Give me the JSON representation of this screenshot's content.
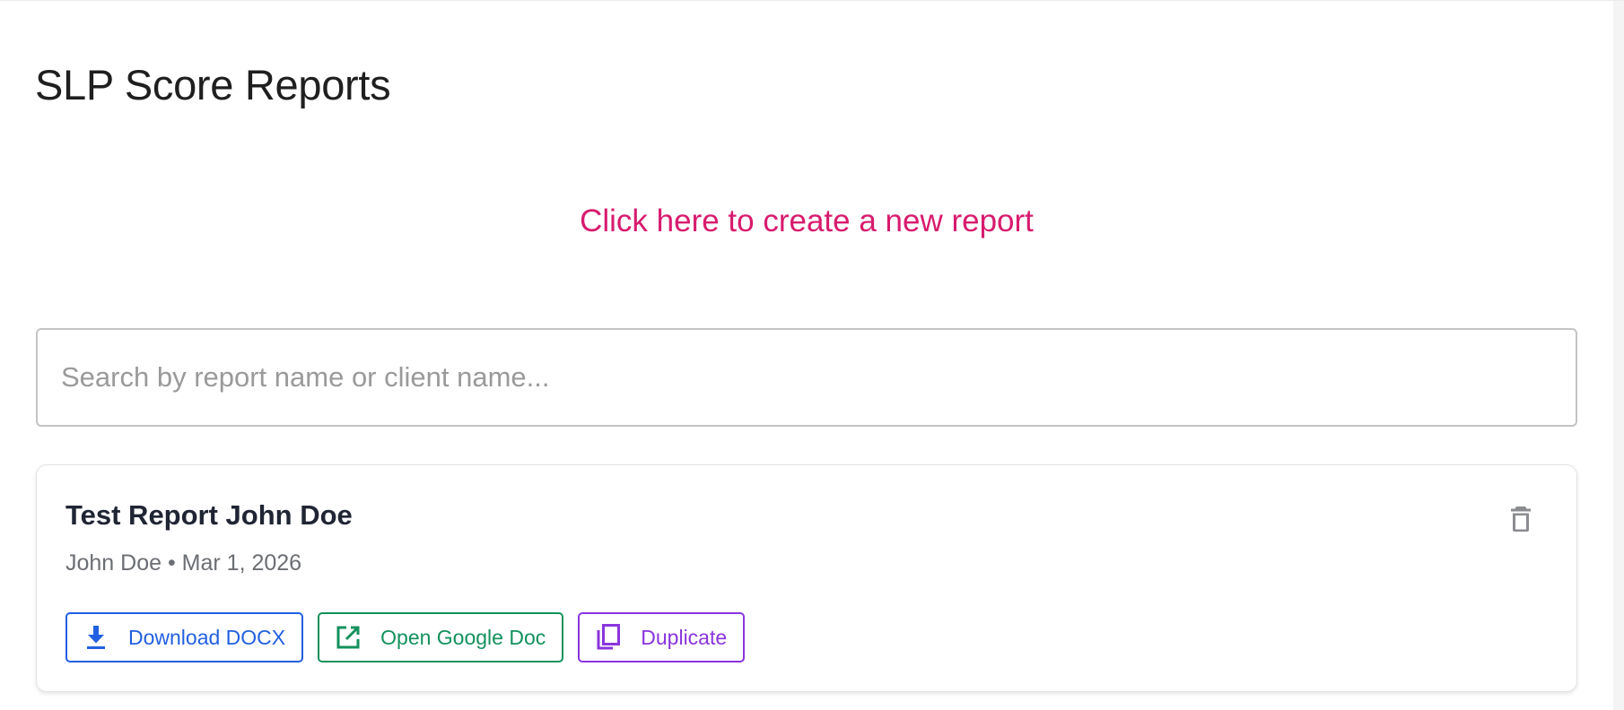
{
  "page": {
    "title": "SLP Score Reports",
    "create_link": "Click here to create a new report"
  },
  "search": {
    "placeholder": "Search by report name or client name...",
    "value": ""
  },
  "reports": [
    {
      "title": "Test Report John Doe",
      "meta": "John Doe • Mar 1, 2026",
      "actions": {
        "download": {
          "label": "Download DOCX",
          "icon": "download-icon",
          "color": "#2160e0"
        },
        "google": {
          "label": "Open Google Doc",
          "icon": "open-external-icon",
          "color": "#13915c"
        },
        "duplicate": {
          "label": "Duplicate",
          "icon": "copy-icon",
          "color": "#8a34dd"
        }
      },
      "delete_icon": "trash-icon"
    }
  ],
  "colors": {
    "accent_link": "#d81b6e",
    "text_primary": "#1f2533",
    "text_secondary": "#6b6e73"
  }
}
